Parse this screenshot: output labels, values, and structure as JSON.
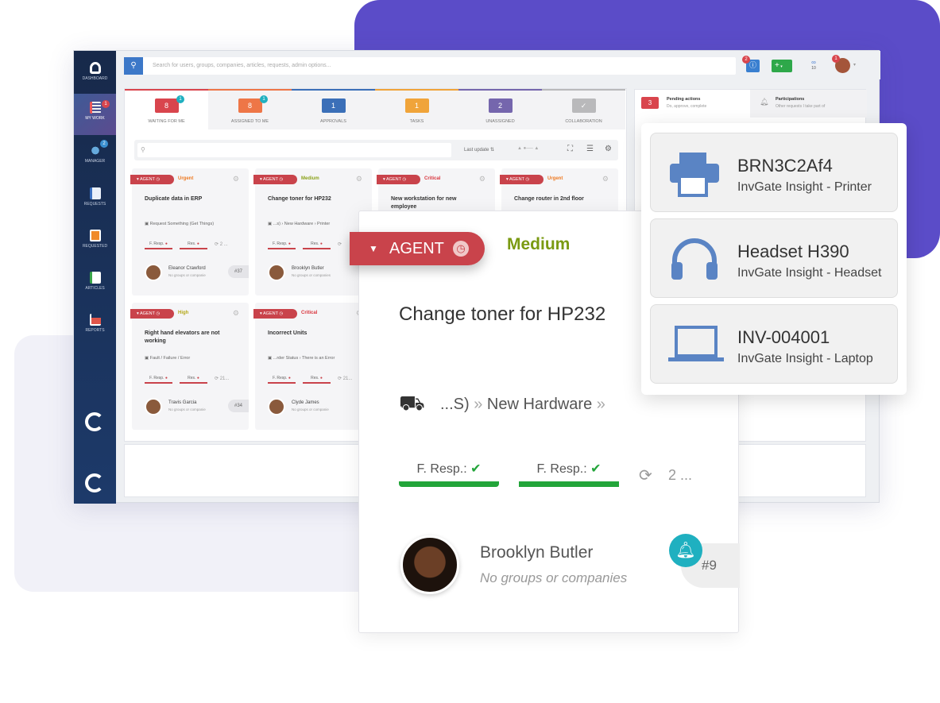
{
  "sidebar": {
    "items": [
      {
        "label": "DASHBOARD",
        "icon": "gauge-icon"
      },
      {
        "label": "MY WORK",
        "icon": "list-icon",
        "badge": "1"
      },
      {
        "label": "MANAGER",
        "icon": "team-icon",
        "badge": "2"
      },
      {
        "label": "REQUESTS",
        "icon": "document-icon"
      },
      {
        "label": "REQUESTED",
        "icon": "document-orange-icon"
      },
      {
        "label": "ARTICLES",
        "icon": "article-icon"
      },
      {
        "label": "REPORTS",
        "icon": "chart-icon"
      }
    ]
  },
  "topbar": {
    "search_placeholder": "Search for users, groups, companies, articles, requests, admin options...",
    "notif_badge": "2",
    "avatar_badge": "1",
    "links_count": "10"
  },
  "tabs": [
    {
      "label": "WAITING FOR ME",
      "count": "8",
      "badge": "1",
      "color": "#d9454d"
    },
    {
      "label": "ASSIGNED TO ME",
      "count": "8",
      "badge": "1",
      "color": "#ee7647"
    },
    {
      "label": "APPROVALS",
      "count": "1",
      "color": "#3b6fb8"
    },
    {
      "label": "TASKS",
      "count": "1",
      "color": "#f0a43a"
    },
    {
      "label": "UNASSIGNED",
      "count": "2",
      "color": "#7566ad"
    },
    {
      "label": "COLLABORATION",
      "count": "✓",
      "color": "#b9b9bb"
    }
  ],
  "filter": {
    "sort_label": "Last update"
  },
  "cards": [
    {
      "tag": "AGENT",
      "priority": "Urgent",
      "priority_color": "#ee7a22",
      "title": "Duplicate data in ERP",
      "path": "Request Something (Get Things)",
      "sla1": "F. Resp.",
      "sla2": "Res.",
      "extra": "2 ...",
      "name": "Eleanor Crawford",
      "sub": "No groups or companie",
      "num": "#37"
    },
    {
      "tag": "AGENT",
      "priority": "Medium",
      "priority_color": "#8ba21a",
      "title": "Change toner for HP232",
      "path": "...s) › New Hardware › Printer",
      "sla1": "F. Resp.",
      "sla2": "Res.",
      "extra": "",
      "name": "Brooklyn Butler",
      "sub": "No groups or companies",
      "num": ""
    },
    {
      "tag": "AGENT",
      "priority": "Critical",
      "priority_color": "#d9353d",
      "title": "New workstation for new employee",
      "path": "",
      "sla1": "",
      "sla2": "",
      "extra": "",
      "name": "",
      "sub": "",
      "num": ""
    },
    {
      "tag": "AGENT",
      "priority": "Urgent",
      "priority_color": "#ee7a22",
      "title": "Change router in 2nd floor",
      "path": "",
      "sla1": "",
      "sla2": "",
      "extra": "",
      "name": "",
      "sub": "",
      "num": ""
    },
    {
      "tag": "AGENT",
      "priority": "High",
      "priority_color": "#b5a91a",
      "title": "Right hand elevators are not working",
      "path": "Fault / Failure / Error",
      "sla1": "F. Resp.",
      "sla2": "Res.",
      "extra": "21...",
      "name": "Travis Garcia",
      "sub": "No groups or companie",
      "num": "#34"
    },
    {
      "tag": "AGENT",
      "priority": "Critical",
      "priority_color": "#d9353d",
      "title": "Incorrect Units",
      "path": "...rder Status › There is an Error",
      "sla1": "F. Resp.",
      "sla2": "Res.",
      "extra": "21...",
      "name": "Clyde James",
      "sub": "No groups or companie",
      "num": ""
    }
  ],
  "right_panel": {
    "pending_count": "3",
    "pending_title": "Pending actions",
    "pending_sub": "Do, approve, complete",
    "part_title": "Participations",
    "part_sub": "Other requests I take part of"
  },
  "detail": {
    "tag": "AGENT",
    "priority": "Medium",
    "priority_color": "#7a9a12",
    "title": "Change toner for HP232",
    "path_prefix": "...S)",
    "path_item": "New Hardware",
    "sla1": "F. Resp.:",
    "sla2": "F. Resp.:",
    "extra": "2 ...",
    "name": "Brooklyn Butler",
    "sub": "No groups or companies",
    "num": "#9"
  },
  "devices": [
    {
      "name": "BRN3C2Af4",
      "type": "InvGate Insight - Printer",
      "icon": "printer-icon"
    },
    {
      "name": "Headset H390",
      "type": "InvGate Insight - Headset",
      "icon": "headset-icon"
    },
    {
      "name": "INV-004001",
      "type": "InvGate Insight - Laptop",
      "icon": "laptop-icon"
    }
  ]
}
